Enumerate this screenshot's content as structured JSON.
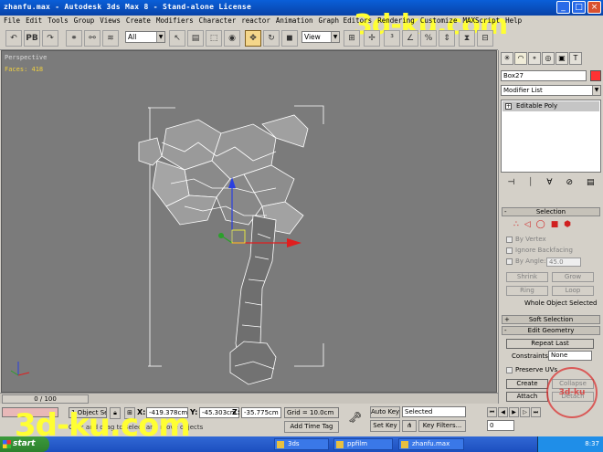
{
  "window": {
    "title": "zhanfu.max - Autodesk 3ds Max 8  - Stand-alone License",
    "site_tag": "www.zealsoft.com",
    "watermark_top": "3d-ku.com",
    "watermark_bottom": "3d-ku.com",
    "buttons": [
      "minimize",
      "maximize",
      "close"
    ]
  },
  "menu": [
    "File",
    "Edit",
    "Tools",
    "Group",
    "Views",
    "Create",
    "Modifiers",
    "Character",
    "reactor",
    "Animation",
    "Graph Editors",
    "Rendering",
    "Customize",
    "MAXScript",
    "Help"
  ],
  "toolbar": {
    "selection_filter": "All",
    "reference_coord": "View",
    "icons": [
      "undo-icon",
      "pb-icon",
      "redo-icon",
      "link-icon",
      "unlink-icon",
      "bind-icon",
      "select-icon",
      "select-by-name-icon",
      "rect-region-icon",
      "window-crossing-icon",
      "select-move-icon",
      "select-rotate-icon",
      "select-scale-icon",
      "pivot-icon",
      "manipulate-icon",
      "snap-icon",
      "angle-snap-icon",
      "percent-snap-icon",
      "spinner-snap-icon",
      "mirror-icon",
      "align-icon",
      "layer-icon",
      "curve-editor-icon",
      "schematic-icon",
      "material-icon",
      "render-icon"
    ],
    "pb_label": "PB"
  },
  "viewport": {
    "label": "Perspective",
    "faces": "Faces: 418"
  },
  "command_panel": {
    "object_name": "Box27",
    "modifier_list": "Modifier List",
    "stack_item": "Editable Poly",
    "selection_rollout": "Selection",
    "by_vertex": "By Vertex",
    "ignore_backfacing": "Ignore Backfacing",
    "by_angle": "By Angle:",
    "by_angle_value": "45.0",
    "shrink": "Shrink",
    "grow": "Grow",
    "ring": "Ring",
    "loop": "Loop",
    "whole_object": "Whole Object Selected",
    "soft_selection": "Soft Selection",
    "edit_geometry": "Edit Geometry",
    "repeat_last": "Repeat Last",
    "constraints_label": "Constraints:",
    "constraints_value": "None",
    "preserve_uvs": "Preserve UVs",
    "create": "Create",
    "collapse": "Collapse",
    "attach": "Attach",
    "detach": "Detach",
    "plus": "+",
    "minus": "-"
  },
  "timeline": {
    "frame": "0 / 100"
  },
  "status": {
    "selected": "1 Object Sel",
    "x_label": "X:",
    "x_value": "-419.378cm",
    "y_label": "Y:",
    "y_value": "-45.303cm",
    "z_label": "Z:",
    "z_value": "-35.775cm",
    "grid": "Grid = 10.0cm",
    "add_time_tag": "Add Time Tag",
    "prompt": "Click and drag to select and move objects",
    "auto_key": "Auto Key",
    "auto_key_value": "Selected",
    "set_key": "Set Key",
    "key_filters": "Key Filters...",
    "frame_value": "0"
  },
  "taskbar": {
    "start": "start",
    "tasks": [
      "zhanfu.max",
      "ppfilm",
      "3ds"
    ],
    "clock": "8:37"
  },
  "seal_text": "3d-ku"
}
